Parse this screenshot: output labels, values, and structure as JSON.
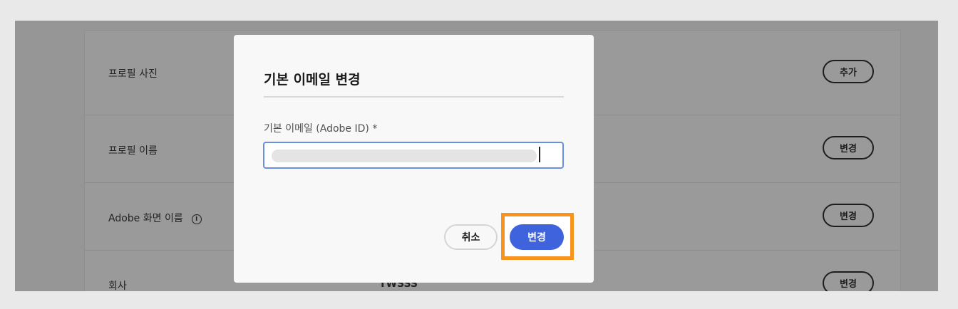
{
  "settings": {
    "rows": [
      {
        "label": "프로필 사진",
        "button": "추가"
      },
      {
        "label": "프로필 이름",
        "button": "변경"
      },
      {
        "label": "Adobe 화면 이름",
        "button": "변경",
        "info_icon": "info-icon"
      },
      {
        "label": "회사",
        "value": "TWSSS",
        "button": "변경"
      }
    ]
  },
  "modal": {
    "title": "기본 이메일 변경",
    "field_label": "기본 이메일 (Adobe ID) *",
    "email_value": "",
    "cancel_label": "취소",
    "confirm_label": "변경"
  },
  "colors": {
    "primary": "#3e63dd",
    "highlight": "#f7941d",
    "overlay": "#969696"
  }
}
